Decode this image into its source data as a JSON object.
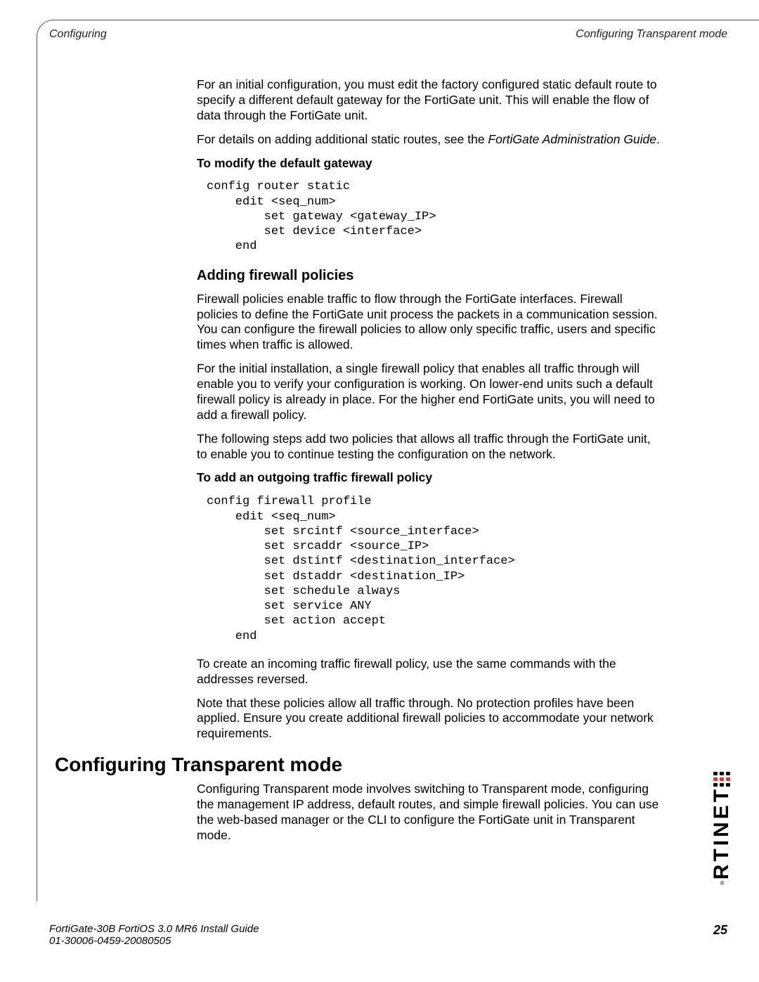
{
  "header": {
    "left": "Configuring",
    "right": "Configuring Transparent mode"
  },
  "intro": {
    "p1": "For an initial configuration, you must edit the factory configured static default route to specify a different default gateway for the FortiGate unit. This will enable the flow of data through the FortiGate unit.",
    "p2_prefix": "For details on adding additional static routes, see the ",
    "p2_em": "FortiGate Administration Guide",
    "p2_suffix": "."
  },
  "gateway": {
    "heading": "To modify the default gateway",
    "code": "config router static\n    edit <seq_num>\n        set gateway <gateway_IP>\n        set device <interface>\n    end"
  },
  "firewall": {
    "title": "Adding firewall policies",
    "p1": "Firewall policies enable traffic to flow through the FortiGate interfaces. Firewall policies to define the FortiGate unit process the packets in a communication session. You can configure the firewall policies to allow only specific traffic, users and specific times when traffic is allowed.",
    "p2": "For the initial installation, a single firewall policy that enables all traffic through will enable you to verify your configuration is working. On lower-end units such a default firewall policy is already in place. For the higher end FortiGate units, you will need to add a firewall policy.",
    "p3": "The following steps add two policies that allows all traffic through the FortiGate unit, to enable you to continue testing the configuration on the network.",
    "sub_heading": "To add an outgoing traffic firewall policy",
    "code": "config firewall profile\n    edit <seq_num>\n        set srcintf <source_interface>\n        set srcaddr <source_IP>\n        set dstintf <destination_interface>\n        set dstaddr <destination_IP>\n        set schedule always\n        set service ANY\n        set action accept\n    end",
    "p4": "To create an incoming traffic firewall policy, use the same commands with the addresses reversed.",
    "p5": "Note that these policies allow all traffic through. No protection profiles have been applied. Ensure you create additional firewall policies to accommodate your network requirements."
  },
  "transparent": {
    "title": "Configuring Transparent mode",
    "p1": "Configuring Transparent mode involves switching to Transparent mode, configuring the management IP address, default routes, and simple firewall policies. You can use the web-based manager or the CLI to configure the FortiGate unit in Transparent mode."
  },
  "footer": {
    "line1": "FortiGate-30B FortiOS 3.0 MR6 Install Guide",
    "line2": "01-30006-0459-20080505",
    "page": "25"
  },
  "logo": {
    "text": "RTINET",
    "reg": "®"
  }
}
